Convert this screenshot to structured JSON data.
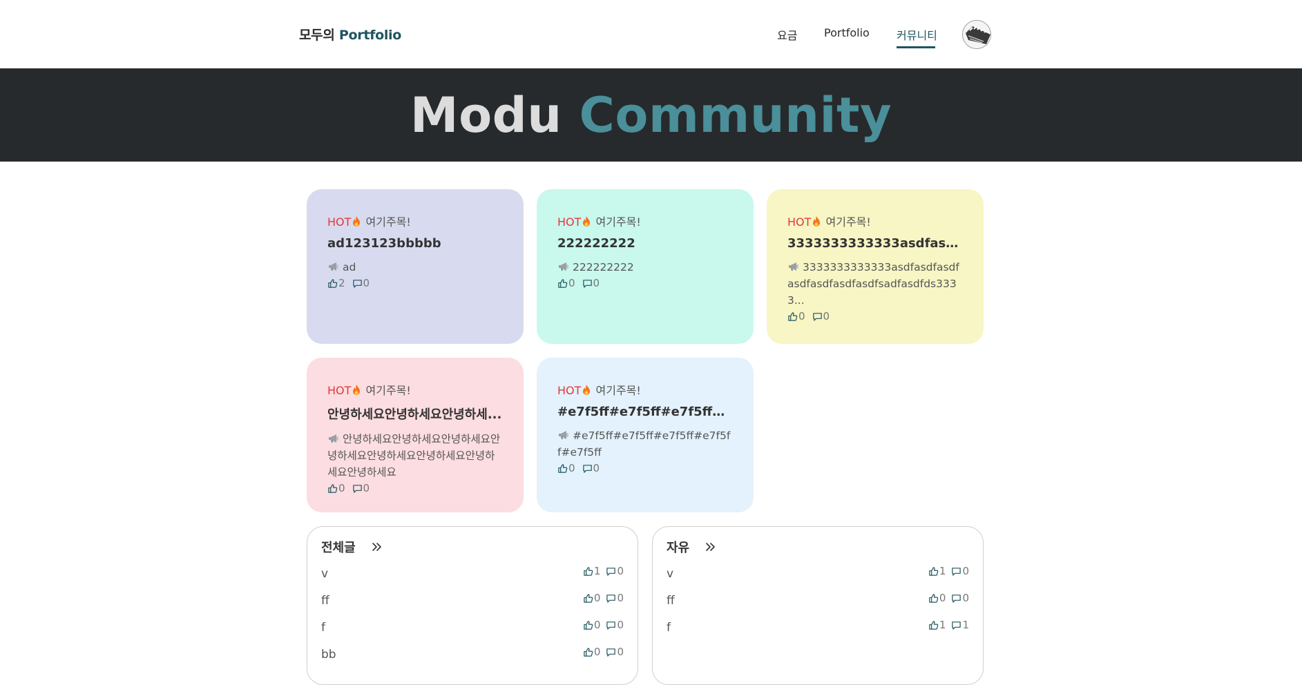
{
  "header": {
    "logo_prefix": "모두의",
    "logo_accent": "Portfolio",
    "nav": [
      {
        "label": "요금"
      },
      {
        "label": "Portfolio"
      },
      {
        "label": "커뮤니티"
      }
    ],
    "active_nav": "커뮤니티"
  },
  "banner": {
    "title_white": "Modu",
    "title_accent": "Community"
  },
  "hot_cards": [
    {
      "hot": "HOT",
      "tag": "여기주목!",
      "title": "ad123123bbbbb",
      "body": "ad",
      "likes": "2",
      "comments": "0",
      "bg": "#d8dbef"
    },
    {
      "hot": "HOT",
      "tag": "여기주목!",
      "title": "222222222",
      "body": "222222222",
      "likes": "0",
      "comments": "0",
      "bg": "#c9f8ec"
    },
    {
      "hot": "HOT",
      "tag": "여기주목!",
      "title": "3333333333333asdfasdfa...",
      "body": "3333333333333asdfasdfasdfasdfasdfasdfasdfsadfasdfds3333...",
      "likes": "0",
      "comments": "0",
      "bg": "#f7f6c4"
    },
    {
      "hot": "HOT",
      "tag": "여기주목!",
      "title": "안녕하세요안녕하세요안녕하세...",
      "body": "안녕하세요안녕하세요안녕하세요안녕하세요안녕하세요안녕하세요안녕하세요안녕하세요",
      "likes": "0",
      "comments": "0",
      "bg": "#fcdde1"
    },
    {
      "hot": "HOT",
      "tag": "여기주목!",
      "title": "#e7f5ff#e7f5ff#e7f5ff#e7f...",
      "body": "#e7f5ff#e7f5ff#e7f5ff#e7f5ff#e7f5ff",
      "likes": "0",
      "comments": "0",
      "bg": "#e3f2fc"
    }
  ],
  "panels": [
    {
      "title": "전체글",
      "rows": [
        {
          "title": "v",
          "likes": "1",
          "comments": "0"
        },
        {
          "title": "ff",
          "likes": "0",
          "comments": "0"
        },
        {
          "title": "f",
          "likes": "0",
          "comments": "0"
        },
        {
          "title": "bb",
          "likes": "0",
          "comments": "0"
        }
      ]
    },
    {
      "title": "자유",
      "rows": [
        {
          "title": "v",
          "likes": "1",
          "comments": "0"
        },
        {
          "title": "ff",
          "likes": "0",
          "comments": "0"
        },
        {
          "title": "f",
          "likes": "1",
          "comments": "1"
        }
      ]
    }
  ],
  "icons": {
    "like": "thumbs-up-icon",
    "comment": "comment-icon",
    "megaphone": "megaphone-icon",
    "fire": "fire-icon",
    "more": "chevrons-right-icon"
  },
  "colors": {
    "accent": "#1e5560",
    "banner_bg": "#262a2c",
    "banner_accent": "#4a8f99",
    "hot_red": "#e8363a"
  }
}
